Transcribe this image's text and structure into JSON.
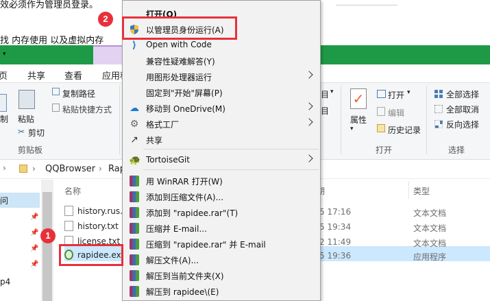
{
  "top_fragment": "效必须作为管理员登录。",
  "top_fragment_2": "找 内存使用 以及虚拟内存",
  "ribbon": {
    "tabs": [
      "页",
      "共享",
      "查看",
      "应用程"
    ],
    "copy_path": "复制路径",
    "paste_shortcut": "粘贴快捷方式",
    "cut_left": "制",
    "paste": "粘贴",
    "cut": "剪切",
    "clipboard_group": "剪贴板",
    "partial_right_1": "目",
    "partial_right_2": "目",
    "properties": "属性",
    "open": "打开",
    "edit": "编辑",
    "history": "历史记录",
    "open_group": "打开",
    "select_all": "全部选择",
    "select_none": "全部取消",
    "invert_select": "反向选择",
    "select_group": "选择"
  },
  "address": {
    "crumb1": "QQBrowser",
    "crumb2": "Rap"
  },
  "list": {
    "col_name": "名称",
    "col_date": "期",
    "col_type": "类型",
    "nav_items": [
      "问",
      "p4"
    ],
    "files": [
      {
        "name": "history.rus.",
        "date": "/5 17:16",
        "type": "文本文档"
      },
      {
        "name": "history.txt",
        "date": "/5 19:34",
        "type": "文本文档"
      },
      {
        "name": "license.txt",
        "date": "/2 11:49",
        "type": "文本文档"
      },
      {
        "name": "rapidee.ex",
        "date": "/5 19:36",
        "type": "应用程序"
      }
    ]
  },
  "menu": {
    "items": [
      {
        "label": "打开(O)",
        "bold": true
      },
      {
        "label": "以管理员身份运行(A)",
        "icon": "shield-icon"
      },
      {
        "label": "Open with Code",
        "icon": "vscode-icon"
      },
      {
        "label": "兼容性疑难解答(Y)"
      },
      {
        "label": "用图形处理器运行",
        "submenu": true
      },
      {
        "label": "固定到\"开始\"屏幕(P)"
      },
      {
        "label": "移动到 OneDrive(M)",
        "icon": "onedrive-icon",
        "submenu": true
      },
      {
        "label": "格式工厂",
        "icon": "format-factory-icon",
        "submenu": true
      },
      {
        "label": "共享",
        "icon": "share-icon"
      },
      {
        "label": "TortoiseGit",
        "icon": "tortoisegit-icon",
        "submenu": true
      },
      {
        "label": "用 WinRAR 打开(W)",
        "icon": "winrar-icon"
      },
      {
        "label": "添加到压缩文件(A)...",
        "icon": "winrar-icon"
      },
      {
        "label": "添加到 \"rapidee.rar\"(T)",
        "icon": "winrar-icon"
      },
      {
        "label": "压缩并 E-mail...",
        "icon": "winrar-icon"
      },
      {
        "label": "压缩到 \"rapidee.rar\" 并 E-mail",
        "icon": "winrar-icon"
      },
      {
        "label": "解压文件(A)...",
        "icon": "winrar-icon"
      },
      {
        "label": "解压到当前文件夹(X)",
        "icon": "winrar-icon"
      },
      {
        "label": "解压到 rapidee\\(E)",
        "icon": "winrar-icon"
      }
    ]
  },
  "badges": {
    "one": "1",
    "two": "2"
  },
  "colors": {
    "green_bar": "#1e9a47",
    "highlight_red": "#e8303a",
    "selection_blue": "#cce8ff"
  }
}
